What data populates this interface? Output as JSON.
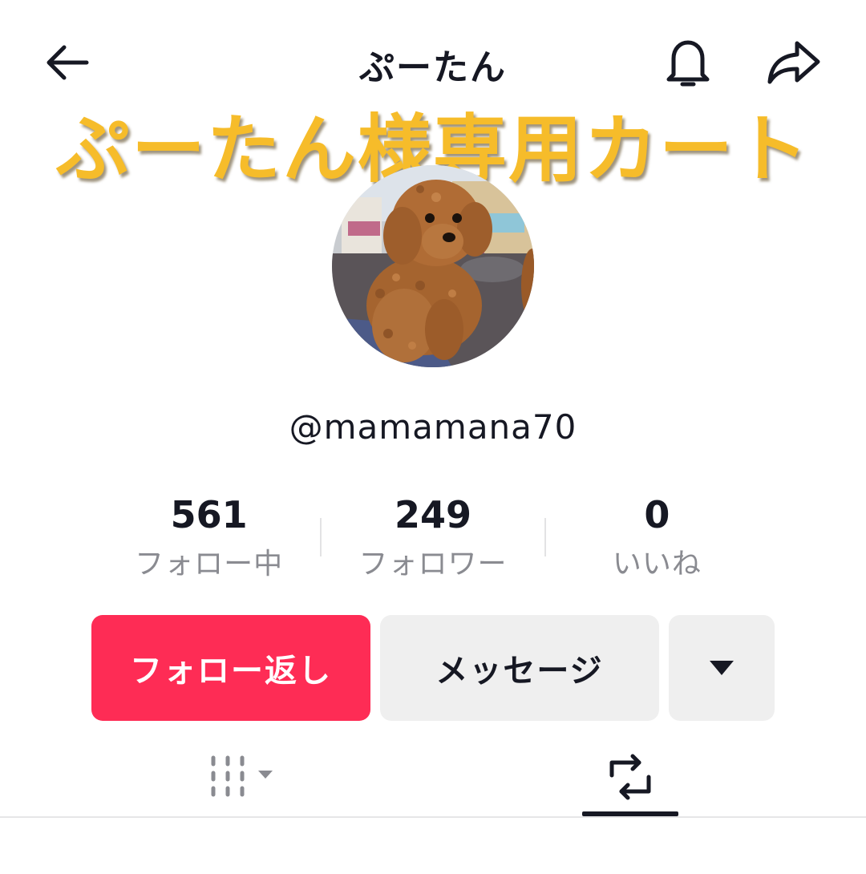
{
  "header": {
    "title": "ぷーたん",
    "back_icon": "back-arrow-icon",
    "bell_icon": "bell-icon",
    "share_icon": "share-icon"
  },
  "overlay": {
    "text": "ぷーたん様専用カート",
    "color": "#f6bc2a"
  },
  "profile": {
    "avatar": "poodle-avatar",
    "username": "@mamamana70"
  },
  "stats": [
    {
      "value": "561",
      "label": "フォロー中"
    },
    {
      "value": "249",
      "label": "フォロワー"
    },
    {
      "value": "0",
      "label": "いいね"
    }
  ],
  "actions": {
    "follow_back_label": "フォロー返し",
    "message_label": "メッセージ",
    "more_icon": "dropdown-triangle-icon"
  },
  "tabs": [
    {
      "icon": "videos-grid-icon",
      "active": false
    },
    {
      "icon": "repost-icon",
      "active": true
    }
  ],
  "colors": {
    "accent": "#fe2c55",
    "secondary_button": "#efefef",
    "muted_text": "#8a8b91",
    "text": "#161823"
  }
}
